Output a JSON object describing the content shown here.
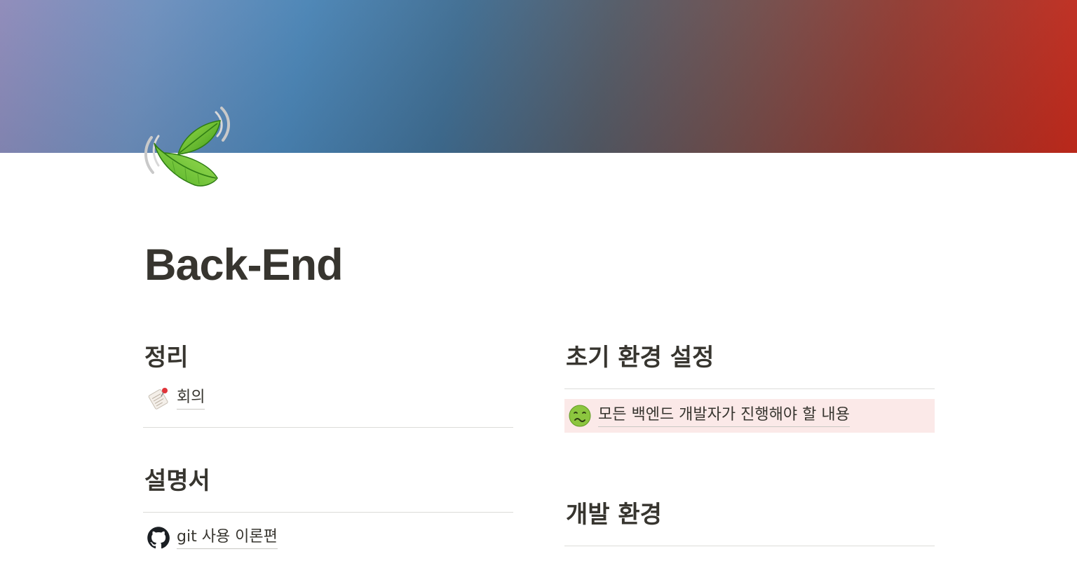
{
  "page": {
    "title": "Back-End",
    "icon": "leaf-fluttering-in-wind-icon"
  },
  "colors": {
    "text": "#37352f",
    "callout_bg": "#fbe9e8",
    "divider": "#dcdcd9"
  },
  "left_column": {
    "sections": [
      {
        "heading": "정리",
        "links": [
          {
            "label": "회의",
            "icon": "memo-pushpin-icon"
          }
        ]
      },
      {
        "heading": "설명서",
        "links": [
          {
            "label": "git 사용 이론편",
            "icon": "github-icon"
          }
        ]
      }
    ]
  },
  "right_column": {
    "sections": [
      {
        "heading": "초기 환경 설정",
        "links": [
          {
            "label": "모든 백엔드 개발자가 진행해야 할 내용",
            "icon": "nauseated-face-icon"
          }
        ]
      },
      {
        "heading": "개발 환경",
        "links": []
      }
    ]
  }
}
